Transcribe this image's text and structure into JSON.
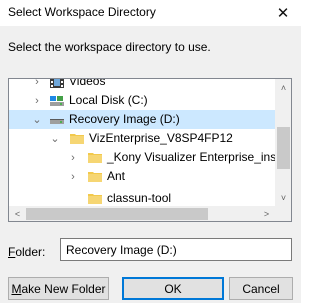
{
  "dialog": {
    "title": "Select Workspace Directory",
    "close_glyph": "✕",
    "instruction": "Select the workspace directory to use."
  },
  "tree": {
    "nodes": [
      {
        "label": "Videos",
        "icon": "videos-folder-icon",
        "expander": "collapsed"
      },
      {
        "label": "Local Disk (C:)",
        "icon": "drive-icon",
        "expander": "collapsed"
      },
      {
        "label": "Recovery Image (D:)",
        "icon": "drive-icon",
        "expander": "expanded",
        "selected": true
      },
      {
        "label": "VizEnterprise_V8SP4FP12",
        "icon": "folder-icon",
        "expander": "expanded"
      },
      {
        "label": "_Kony Visualizer Enterprise_instal",
        "icon": "folder-icon",
        "expander": "collapsed"
      },
      {
        "label": "Ant",
        "icon": "folder-icon",
        "expander": "collapsed"
      },
      {
        "label": "classun-tool",
        "icon": "folder-icon",
        "expander": "none"
      }
    ],
    "scroll_up": "˄",
    "scroll_down": "˅",
    "scroll_left": "<",
    "scroll_right": ">"
  },
  "folder_field": {
    "label_mnemonic": "F",
    "label_rest": "older:",
    "value": "Recovery Image (D:)"
  },
  "buttons": {
    "make_new_folder_mnemonic": "M",
    "make_new_folder_rest": "ake New Folder",
    "ok": "OK",
    "cancel": "Cancel"
  },
  "colors": {
    "selection": "#cce8ff",
    "folder": "#f2c94c",
    "default_button_border": "#0078d7"
  }
}
